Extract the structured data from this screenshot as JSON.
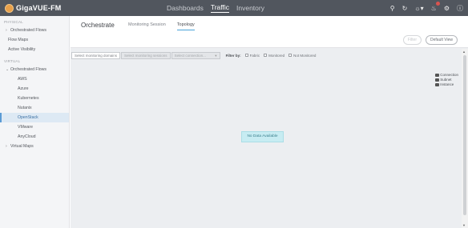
{
  "app": {
    "name": "GigaVUE-FM",
    "colors": {
      "topbar": "#51565e",
      "accent": "#4aa3d9",
      "logo": "#e8a04a"
    }
  },
  "topnav": {
    "items": [
      "Dashboards",
      "Traffic",
      "Inventory"
    ],
    "active": "Traffic"
  },
  "topicons": [
    "search-icon",
    "refresh-icon",
    "help-icon",
    "bell-icon",
    "gear-icon",
    "info-icon"
  ],
  "sidebar": {
    "physical": {
      "title": "PHYSICAL",
      "items": [
        "Orchestrated Flows",
        "Flow Maps",
        "Active Visibility"
      ]
    },
    "virtual": {
      "title": "VIRTUAL",
      "group": "Orchestrated Flows",
      "children": [
        "AWS",
        "Azure",
        "Kubernetes",
        "Nutanix",
        "OpenStack",
        "VMware",
        "AnyCloud"
      ],
      "active": "OpenStack",
      "after": [
        "Virtual Maps"
      ]
    }
  },
  "main": {
    "title": "Orchestrate",
    "tabs": [
      "Monitoring Session",
      "Topology"
    ],
    "active_tab": "Topology",
    "buttons": {
      "filter": "Filter",
      "default_view": "Default View"
    },
    "filters": {
      "domains_placeholder": "Select monitoring domains",
      "sessions_placeholder": "Select monitoring sessions",
      "connection_placeholder": "Select connection...",
      "filter_by": "Filter by:",
      "options": [
        "Fabric",
        "Monitored",
        "Not Monitored"
      ]
    },
    "legend": [
      "Connection",
      "Subnet",
      "Instance"
    ],
    "empty_message": "No Data Available"
  }
}
